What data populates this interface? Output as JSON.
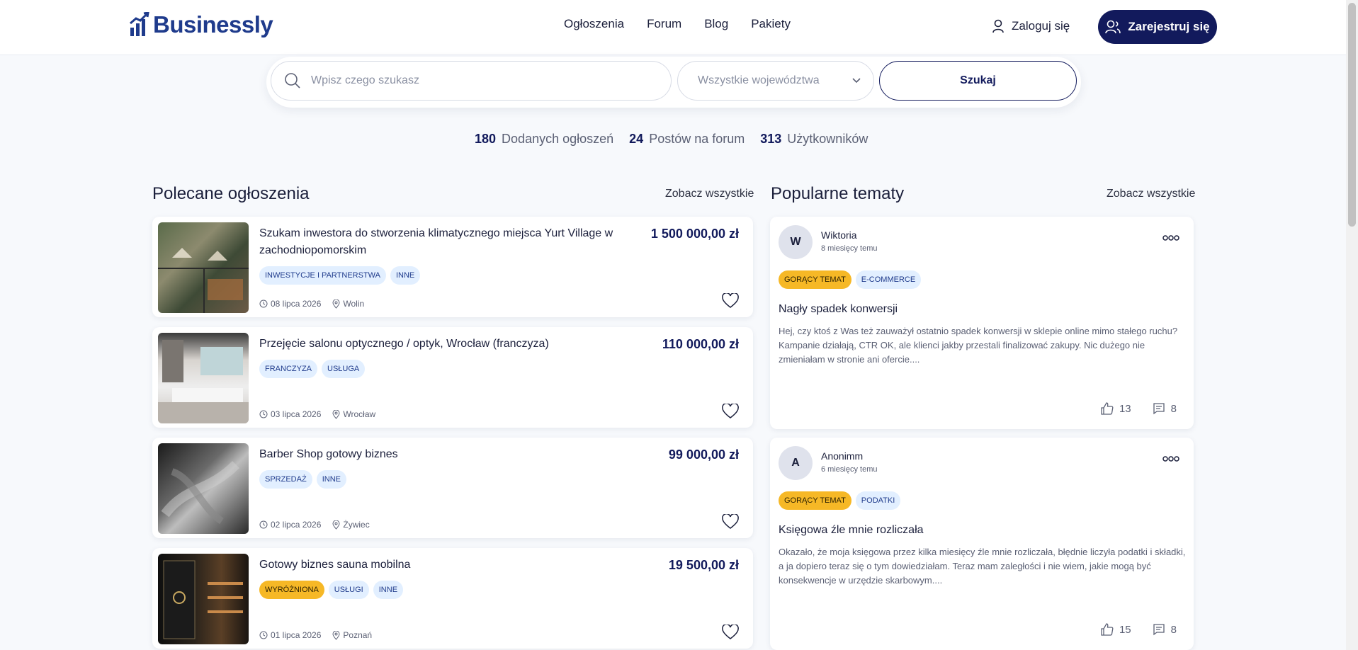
{
  "brand": "Businessly",
  "nav": [
    "Ogłoszenia",
    "Forum",
    "Blog",
    "Pakiety"
  ],
  "auth": {
    "login": "Zaloguj się",
    "register": "Zarejestruj się"
  },
  "search": {
    "placeholder": "Wpisz czego szukasz",
    "region": "Wszystkie województwa",
    "button": "Szukaj"
  },
  "stats": [
    {
      "value": "180",
      "label": "Dodanych ogłoszeń"
    },
    {
      "value": "24",
      "label": "Postów na forum"
    },
    {
      "value": "313",
      "label": "Użytkowników"
    }
  ],
  "listings_section": {
    "title": "Polecane ogłoszenia",
    "see_all": "Zobacz wszystkie"
  },
  "forum_section": {
    "title": "Popularne tematy",
    "see_all": "Zobacz wszystkie"
  },
  "listings": [
    {
      "title": "Szukam inwestora do stworzenia klimatycznego miejsca Yurt Village w zachodniopomorskim",
      "price": "1 500 000,00 zł",
      "tags": [
        "Inwestycje i partnerstwa",
        "Inne"
      ],
      "date": "08 lipca 2026",
      "city": "Wolin"
    },
    {
      "title": "Przejęcie salonu optycznego / optyk, Wrocław (franczyza)",
      "price": "110 000,00 zł",
      "tags": [
        "Franczyza",
        "Usługa"
      ],
      "date": "03 lipca 2026",
      "city": "Wrocław"
    },
    {
      "title": "Barber Shop gotowy biznes",
      "price": "99 000,00 zł",
      "tags": [
        "Sprzedaż",
        "Inne"
      ],
      "date": "02 lipca 2026",
      "city": "Żywiec"
    },
    {
      "title": "Gotowy biznes sauna mobilna",
      "price": "19 500,00 zł",
      "tags": [
        "Wyróżniona",
        "Usługi",
        "Inne"
      ],
      "date": "01 lipca 2026",
      "city": "Poznań"
    }
  ],
  "posts": [
    {
      "initial": "W",
      "author": "Wiktoria",
      "time": "8 miesięcy temu",
      "tags": [
        "Gorący temat",
        "E-commerce"
      ],
      "title": "Nagły spadek konwersji",
      "body": "Hej, czy ktoś z Was też zauważył ostatnio spadek konwersji w sklepie online mimo stałego ruchu? Kampanie działają, CTR OK, ale klienci jakby przestali finalizować zakupy. Nic dużego nie zmieniałam w stronie ani ofercie....",
      "likes": "13",
      "comments": "8"
    },
    {
      "initial": "A",
      "author": "Anonimm",
      "time": "6 miesięcy temu",
      "tags": [
        "Gorący temat",
        "Podatki"
      ],
      "title": "Księgowa źle mnie rozliczała",
      "body": "Okazało, że moja księgowa przez kilka miesięcy źle mnie rozliczała, błędnie liczyła podatki i składki, a ja dopiero teraz się o tym dowiedziałam. Teraz mam zaległości i nie wiem, jakie mogą być konsekwencje w urzędzie skarbowym....",
      "likes": "15",
      "comments": "8"
    }
  ],
  "colors": {
    "primary": "#121a5c",
    "hot": "#f6b826",
    "tag_bg": "#e2efff"
  }
}
